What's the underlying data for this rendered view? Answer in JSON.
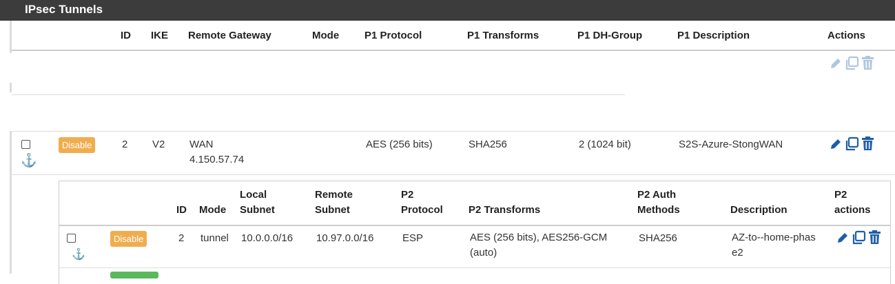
{
  "panel": {
    "title": "IPsec Tunnels"
  },
  "columns": {
    "id": "ID",
    "ike": "IKE",
    "remote_gateway": "Remote Gateway",
    "mode": "Mode",
    "p1_protocol": "P1 Protocol",
    "p1_transforms": "P1 Transforms",
    "p1_dh_group": "P1 DH-Group",
    "p1_description": "P1 Description",
    "actions": "Actions"
  },
  "tunnel": {
    "disable_label": "Disable",
    "id": "2",
    "ike": "V2",
    "gateway_iface": "WAN",
    "gateway_ip": "4.150.57.74",
    "p1_protocol": "AES (256 bits)",
    "p1_transforms": "SHA256",
    "p1_dh_group": "2 (1024 bit)",
    "p1_description": "S2S-Azure-StongWAN"
  },
  "p2_columns": {
    "id": "ID",
    "mode": "Mode",
    "local_subnet": "Local Subnet",
    "remote_subnet": "Remote Subnet",
    "p2_protocol": "P2 Protocol",
    "p2_transforms": "P2 Transforms",
    "p2_auth": "P2 Auth Methods",
    "description": "Description",
    "p2_actions": "P2 actions"
  },
  "p2_entry": {
    "disable_label": "Disable",
    "id": "2",
    "mode": "tunnel",
    "local_subnet": "10.0.0.0/16",
    "remote_subnet": "10.97.0.0/16",
    "protocol": "ESP",
    "transforms": "AES (256 bits), AES256-GCM (auto)",
    "auth": "SHA256",
    "description": "AZ-to--home-phase2"
  },
  "colors": {
    "header_bg": "#3c3c3c",
    "disable_badge": "#f0ad4e",
    "icon_blue": "#1f5ea8"
  },
  "icons": [
    "pencil-icon",
    "copy-icon",
    "trash-icon",
    "anchor-icon"
  ]
}
